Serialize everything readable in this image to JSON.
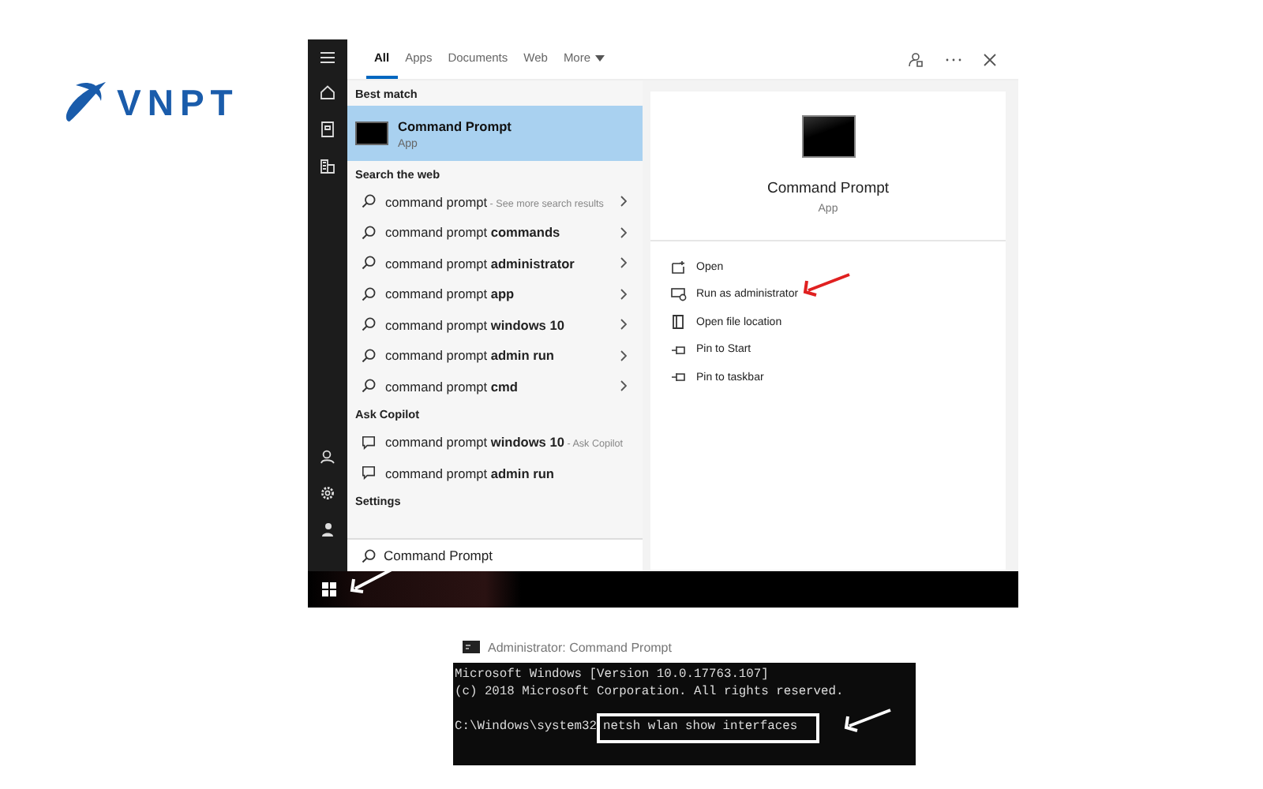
{
  "logo": {
    "text": "VNPT"
  },
  "search_window": {
    "tabs": [
      {
        "label": "All",
        "selected": true,
        "has_menu": false
      },
      {
        "label": "Apps",
        "selected": false,
        "has_menu": false
      },
      {
        "label": "Documents",
        "selected": false,
        "has_menu": false
      },
      {
        "label": "Web",
        "selected": false,
        "has_menu": false
      },
      {
        "label": "More",
        "selected": false,
        "has_menu": true
      }
    ],
    "sections": [
      {
        "heading": "Best match",
        "items": [
          {
            "kind": "app",
            "text": "Command Prompt",
            "subtitle": "App",
            "selected": true
          }
        ]
      },
      {
        "heading": "Search the web",
        "items": [
          {
            "kind": "web",
            "text": "command prompt",
            "suffix": " - See more search results",
            "selected": false
          },
          {
            "kind": "web",
            "text": "command prompt **commands**",
            "selected": false
          },
          {
            "kind": "web",
            "text": "command prompt **administrator**",
            "selected": false
          },
          {
            "kind": "web",
            "text": "command prompt **app**",
            "selected": false
          },
          {
            "kind": "web",
            "text": "command prompt **windows 10**",
            "selected": false
          },
          {
            "kind": "web",
            "text": "command prompt **admin run**",
            "selected": false
          },
          {
            "kind": "web",
            "text": "command prompt **cmd**",
            "selected": false
          }
        ]
      },
      {
        "heading": "Ask Copilot",
        "items": [
          {
            "kind": "copilot",
            "text": "command prompt **windows 10**",
            "suffix": " - Ask Copilot",
            "selected": false
          },
          {
            "kind": "copilot",
            "text": "command prompt **admin run**",
            "selected": false
          }
        ]
      },
      {
        "heading": "Settings"
      }
    ],
    "search_field": {
      "value": "Command Prompt"
    },
    "detail": {
      "title": "Command Prompt",
      "subtitle": "App",
      "actions": [
        {
          "kind": "open",
          "label": "Open"
        },
        {
          "kind": "admin",
          "label": "Run as administrator"
        },
        {
          "kind": "folder",
          "label": "Open file location"
        },
        {
          "kind": "pin",
          "label": "Pin to Start"
        },
        {
          "kind": "pin",
          "label": "Pin to taskbar"
        }
      ]
    }
  },
  "console": {
    "title": "Administrator: Command Prompt",
    "lines": [
      "Microsoft Windows [Version 10.0.17763.107]",
      "(c) 2018 Microsoft Corporation. All rights reserved."
    ],
    "prompt": "C:\\Windows\\system32",
    "command": "netsh wlan show interfaces"
  }
}
